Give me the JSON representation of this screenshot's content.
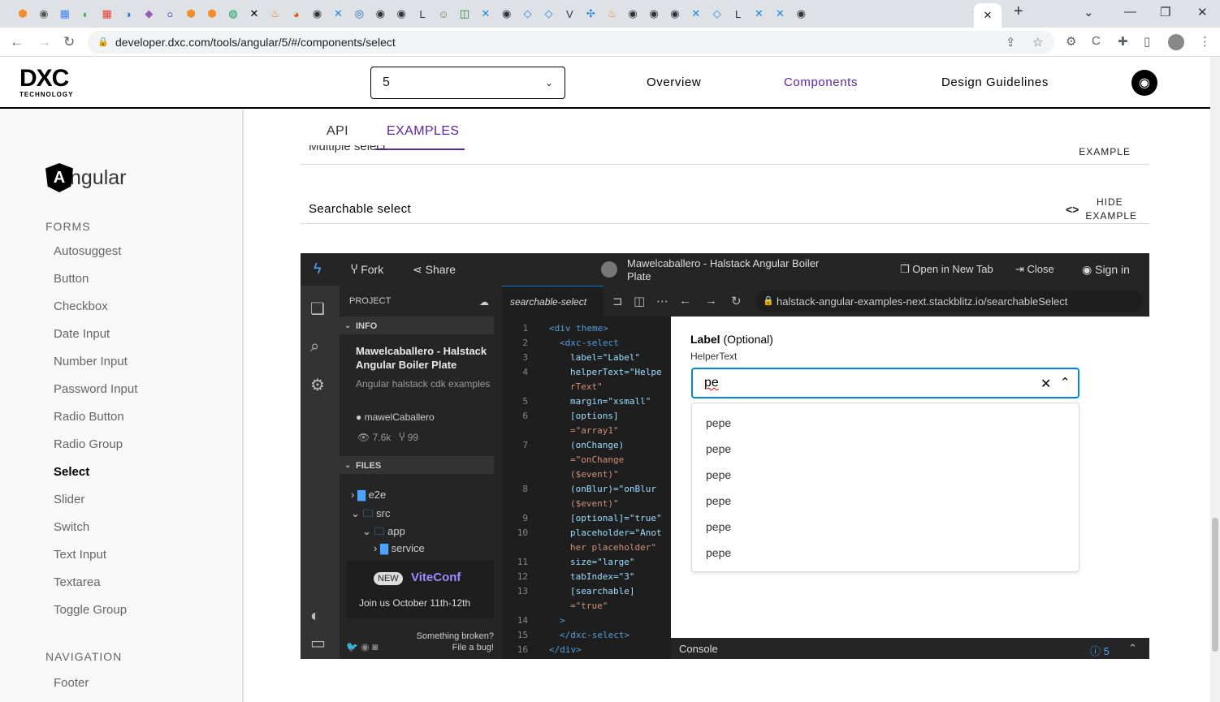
{
  "browser": {
    "active_tab_close": "✕",
    "new_tab": "+",
    "url": "developer.dxc.com/tools/angular/5/#/components/select"
  },
  "header": {
    "logo_mark": "DXC",
    "logo_sub": "TECHNOLOGY",
    "version": "5",
    "nav": [
      "Overview",
      "Components",
      "Design Guidelines"
    ]
  },
  "sidebar": {
    "framework": "ngular",
    "framework_glyph": "A",
    "forms_title": "FORMS",
    "forms": [
      "Autosuggest",
      "Button",
      "Checkbox",
      "Date Input",
      "Number Input",
      "Password Input",
      "Radio Button",
      "Radio Group",
      "Select",
      "Slider",
      "Switch",
      "Text Input",
      "Textarea",
      "Toggle Group"
    ],
    "selected": "Select",
    "navigation_title": "NAVIGATION",
    "navigation": [
      "Footer"
    ]
  },
  "content": {
    "tabs": [
      "API",
      "EXAMPLES"
    ],
    "active_tab": "EXAMPLES",
    "prev_example_title": "Multiple select",
    "prev_example_toggle": "EXAMPLE",
    "example_title": "Searchable select",
    "hide_code": "<>",
    "hide_label_1": "HIDE",
    "hide_label_2": "EXAMPLE"
  },
  "stackblitz": {
    "fork": "Fork",
    "share": "Share",
    "project_title": "Mawelcaballero - Halstack Angular Boiler Plate",
    "open_new_tab": "Open in New Tab",
    "close": "Close",
    "sign_in": "Sign in",
    "project_header": "PROJECT",
    "info_header": "INFO",
    "info_title": "Mawelcaballero - Halstack Angular Boiler Plate",
    "info_desc": "Angular halstack cdk examples",
    "user": "mawelCaballero",
    "views": "7.6k",
    "forks": "99",
    "files_header": "FILES",
    "files": [
      {
        "name": "e2e",
        "level": 0,
        "open": false
      },
      {
        "name": "src",
        "level": 0,
        "open": true
      },
      {
        "name": "app",
        "level": 1,
        "open": true
      },
      {
        "name": "service",
        "level": 2,
        "open": false
      }
    ],
    "vite_new": "NEW",
    "vite_name": "ViteConf",
    "vite_date": "Join us October 11th-12th",
    "broken_1": "Something broken?",
    "broken_2": "File a bug!",
    "editor_tab": "searchable-select",
    "preview_url": "halstack-angular-examples-next.stackblitz.io/searchableSelect",
    "console": "Console",
    "console_count": "5",
    "code_lines": [
      {
        "n": "1",
        "t": "<div theme>",
        "c": "tag",
        "i": 0
      },
      {
        "n": "2",
        "t": "<dxc-select",
        "c": "tag",
        "i": 1
      },
      {
        "n": "3",
        "t": "label=\"Label\"",
        "c": "",
        "i": 2
      },
      {
        "n": "4",
        "t": "helperText=\"Helpe",
        "c": "",
        "i": 2
      },
      {
        "n": "",
        "t": "rText\"",
        "c": "str",
        "i": 2
      },
      {
        "n": "5",
        "t": "margin=\"xsmall\"",
        "c": "",
        "i": 2
      },
      {
        "n": "6",
        "t": "[options]",
        "c": "",
        "i": 2
      },
      {
        "n": "",
        "t": "=\"array1\"",
        "c": "str",
        "i": 2
      },
      {
        "n": "7",
        "t": "(onChange)",
        "c": "",
        "i": 2
      },
      {
        "n": "",
        "t": "=\"onChange",
        "c": "str",
        "i": 2
      },
      {
        "n": "",
        "t": "($event)\"",
        "c": "str",
        "i": 2
      },
      {
        "n": "8",
        "t": "(onBlur)=\"onBlur",
        "c": "",
        "i": 2
      },
      {
        "n": "",
        "t": "($event)\"",
        "c": "str",
        "i": 2
      },
      {
        "n": "9",
        "t": "[optional]=\"true\"",
        "c": "",
        "i": 2
      },
      {
        "n": "10",
        "t": "placeholder=\"Anot",
        "c": "",
        "i": 2
      },
      {
        "n": "",
        "t": "her placeholder\"",
        "c": "str",
        "i": 2
      },
      {
        "n": "11",
        "t": "size=\"large\"",
        "c": "",
        "i": 2
      },
      {
        "n": "12",
        "t": "tabIndex=\"3\"",
        "c": "",
        "i": 2
      },
      {
        "n": "13",
        "t": "[searchable]",
        "c": "",
        "i": 2
      },
      {
        "n": "",
        "t": "=\"true\"",
        "c": "str",
        "i": 2
      },
      {
        "n": "14",
        "t": ">",
        "c": "tag",
        "i": 1
      },
      {
        "n": "15",
        "t": "</dxc-select>",
        "c": "tag",
        "i": 1
      },
      {
        "n": "16",
        "t": "</div>",
        "c": "tag",
        "i": 0
      }
    ]
  },
  "select_preview": {
    "label": "Label",
    "optional": "(Optional)",
    "helper": "HelperText",
    "value": "pe",
    "clear": "✕",
    "toggle": "⌃",
    "options": [
      "pepe",
      "pepe",
      "pepe",
      "pepe",
      "pepe",
      "pepe"
    ]
  }
}
